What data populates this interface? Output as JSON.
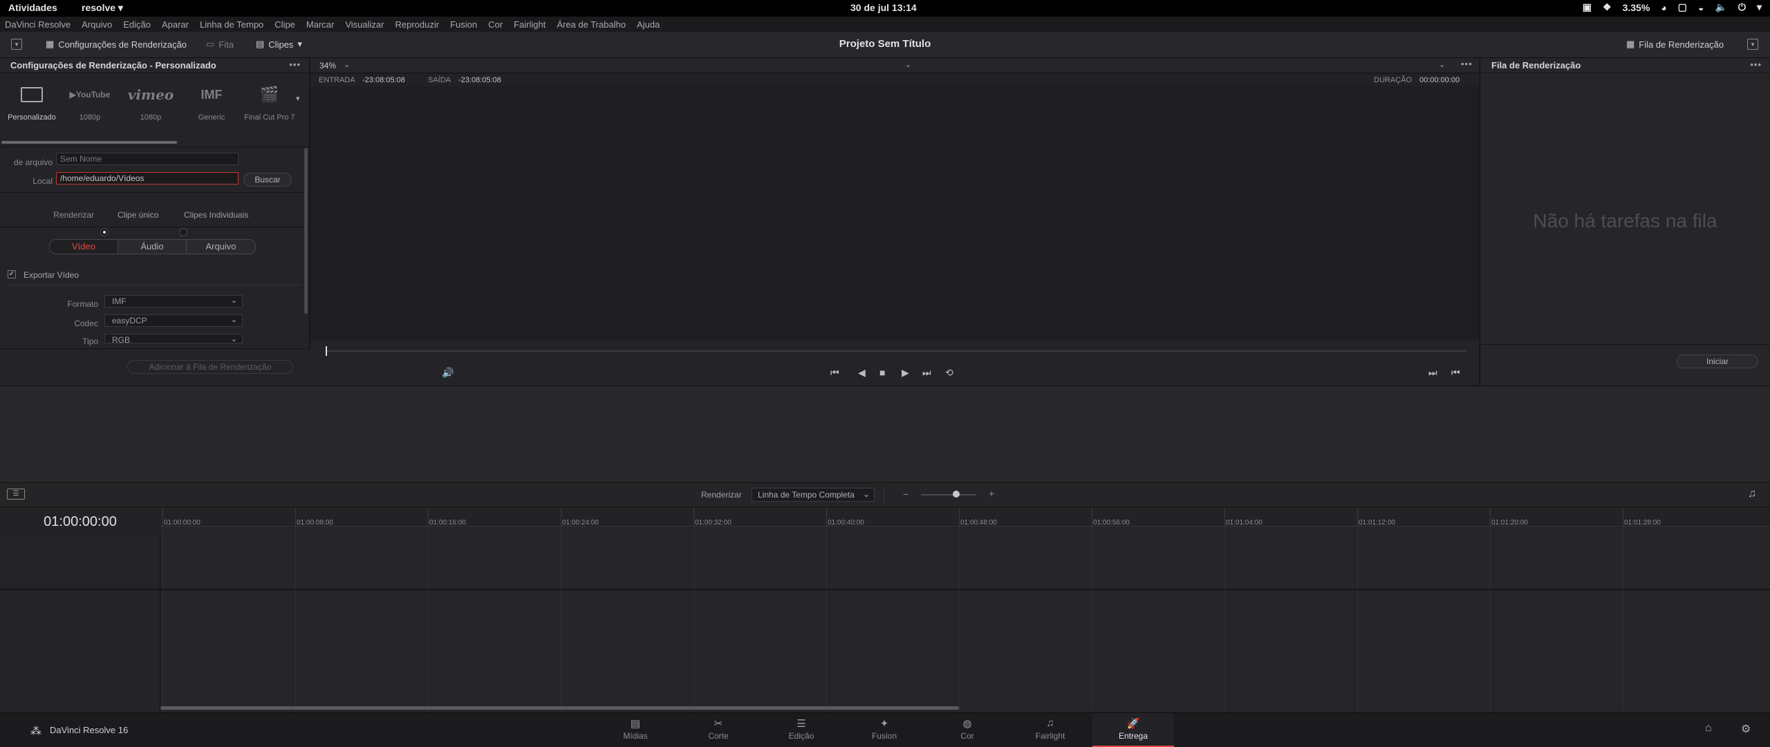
{
  "topbar": {
    "activities": "Atividades",
    "app_menu": "resolve ▾",
    "clock": "30 de jul  13:14",
    "speed": "3.35%"
  },
  "menubar": [
    "DaVinci Resolve",
    "Arquivo",
    "Edição",
    "Aparar",
    "Linha de Tempo",
    "Clipe",
    "Marcar",
    "Visualizar",
    "Reproduzir",
    "Fusion",
    "Cor",
    "Fairlight",
    "Área de Trabalho",
    "Ajuda"
  ],
  "toolbar": {
    "render_settings": "Configurações de Renderização",
    "tape": "Fita",
    "clips": "Clipes",
    "project_title": "Projeto Sem Título",
    "render_queue": "Fila de Renderização"
  },
  "left_panel": {
    "title": "Configurações de Renderização - Personalizado",
    "presets": [
      {
        "logo": "▭",
        "label": "Personalizado"
      },
      {
        "logo": "▶YouTube",
        "label": "1080p"
      },
      {
        "logo": "vimeo",
        "label": "1080p"
      },
      {
        "logo": "IMF",
        "label": "Generic"
      },
      {
        "logo": "🎬",
        "label": "Final Cut Pro 7"
      }
    ],
    "filename_label": "de arquivo",
    "filename_value": "Sem Nome",
    "location_label": "Local",
    "location_value": "/home/eduardo/Vídeos",
    "browse": "Buscar",
    "render_label": "Renderizar",
    "single_clip": "Clipe único",
    "individual_clips": "Clipes Individuais",
    "tabs": [
      "Vídeo",
      "Áudio",
      "Arquivo"
    ],
    "export_video": "Exportar Vídeo",
    "format_label": "Formato",
    "format_value": "IMF",
    "codec_label": "Codec",
    "codec_value": "easyDCP",
    "type_label": "Tipo",
    "type_value": "RGB",
    "add_to_queue": "Adicionar à Fila de Renderização"
  },
  "viewer": {
    "zoom": "34%",
    "in_label": "ENTRADA",
    "in_tc": "-23:08:05:08",
    "out_label": "SAÍDA",
    "out_tc": "-23:08:05:08",
    "dur_label": "DURAÇÃO",
    "dur_tc": "00:00:00:00"
  },
  "queue": {
    "title": "Fila de Renderização",
    "empty": "Não há tarefas na fila",
    "start": "Iniciar"
  },
  "timeline": {
    "render_label": "Renderizar",
    "render_mode": "Linha de Tempo Completa",
    "timecode": "01:00:00:00",
    "ticks": [
      "01:00:00:00",
      "01:00:08:00",
      "01:00:16:00",
      "01:00:24:00",
      "01:00:32:00",
      "01:00:40:00",
      "01:00:48:00",
      "01:00:56:00",
      "01:01:04:00",
      "01:01:12:00",
      "01:01:20:00",
      "01:01:28:00"
    ]
  },
  "pagebar": {
    "app_name": "DaVinci Resolve 16",
    "pages": [
      {
        "icon": "▤",
        "label": "Mídias"
      },
      {
        "icon": "✂",
        "label": "Corte"
      },
      {
        "icon": "☰",
        "label": "Edição"
      },
      {
        "icon": "✦",
        "label": "Fusion"
      },
      {
        "icon": "◍",
        "label": "Cor"
      },
      {
        "icon": "♫",
        "label": "Fairlight"
      },
      {
        "icon": "🚀",
        "label": "Entrega"
      }
    ]
  }
}
